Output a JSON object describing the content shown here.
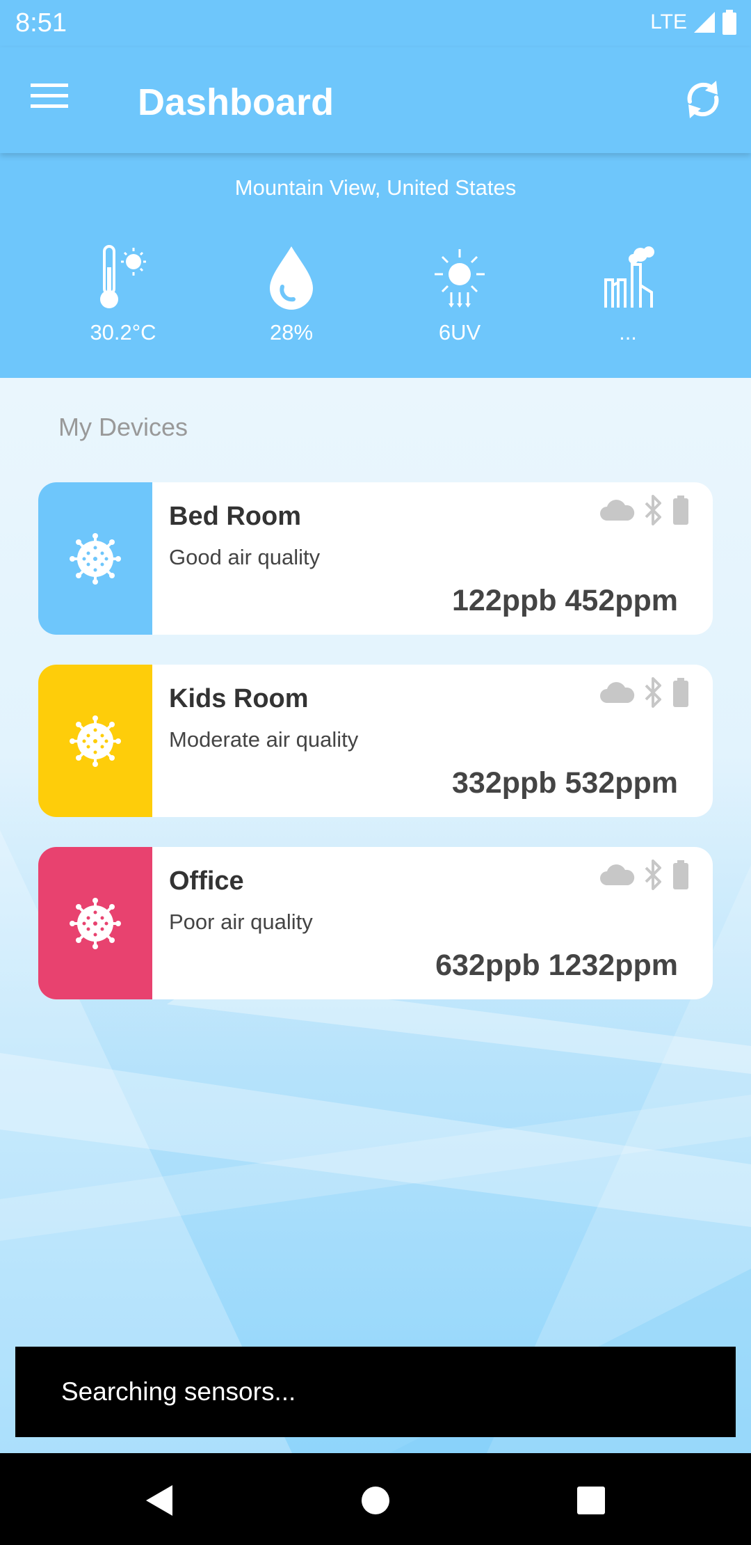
{
  "status_bar": {
    "time": "8:51",
    "network": "LTE"
  },
  "app_bar": {
    "title": "Dashboard",
    "menu_icon": "menu-icon",
    "refresh_icon": "refresh-icon"
  },
  "weather": {
    "location": "Mountain View, United States",
    "items": [
      {
        "icon": "thermometer-icon",
        "value": "30.2°C"
      },
      {
        "icon": "humidity-drop-icon",
        "value": "28%"
      },
      {
        "icon": "uv-sun-icon",
        "value": "6UV"
      },
      {
        "icon": "pollution-factory-icon",
        "value": "..."
      }
    ]
  },
  "devices": {
    "title": "My Devices",
    "items": [
      {
        "name": "Bed Room",
        "quality": "Good air quality",
        "reading": "122ppb 452ppm",
        "color": "#6ec6fb"
      },
      {
        "name": "Kids Room",
        "quality": "Moderate air quality",
        "reading": "332ppb 532ppm",
        "color": "#fecd0a"
      },
      {
        "name": "Office",
        "quality": "Poor air quality",
        "reading": "632ppb 1232ppm",
        "color": "#e8426f"
      }
    ]
  },
  "snackbar": {
    "message": "Searching sensors..."
  },
  "colors": {
    "primary": "#6ec6fb",
    "good": "#6ec6fb",
    "moderate": "#fecd0a",
    "poor": "#e8426f",
    "status_icon": "#c7c7c7"
  }
}
